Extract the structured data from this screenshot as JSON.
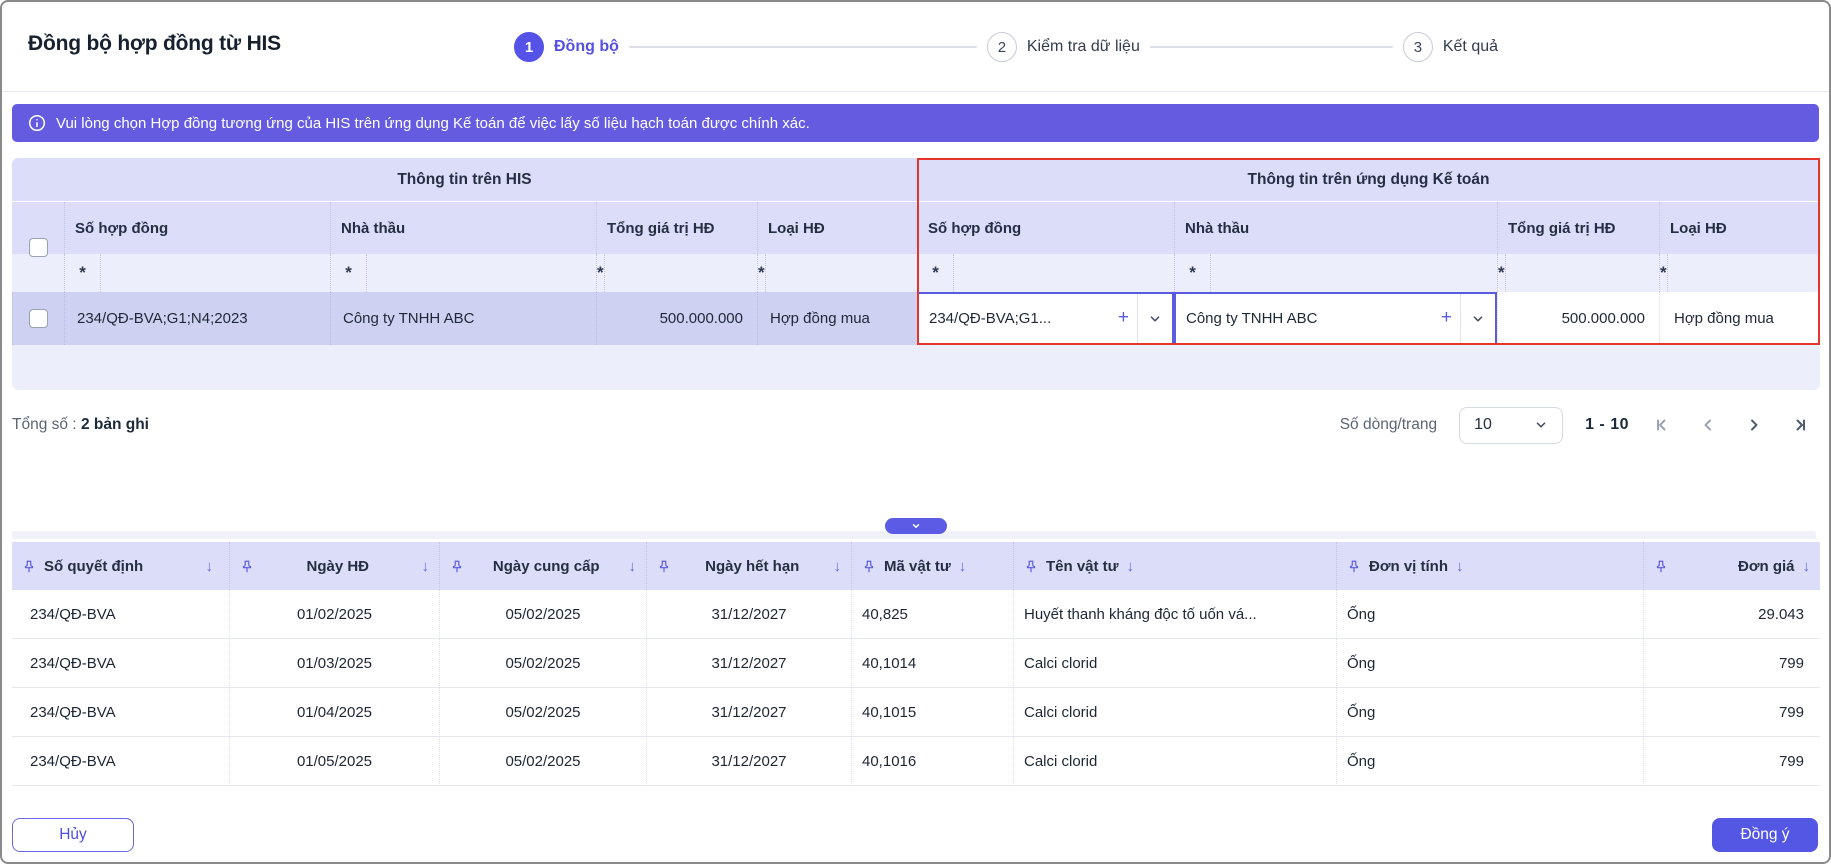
{
  "colors": {
    "accent": "#5552E8",
    "banner_bg": "#655BE1",
    "highlight_border": "#E5342B",
    "table_header_bg": "#DCDDF8",
    "selected_row_bg": "#CFD1F3"
  },
  "icons": {
    "required_marker": "*",
    "add": "+",
    "sort_desc": "↓"
  },
  "page": {
    "title": "Đồng bộ hợp đồng từ HIS"
  },
  "stepper": {
    "steps": [
      {
        "number": "1",
        "label": "Đồng bộ"
      },
      {
        "number": "2",
        "label": "Kiểm tra dữ liệu"
      },
      {
        "number": "3",
        "label": "Kết quả"
      }
    ]
  },
  "banner": {
    "text": "Vui lòng chọn Hợp đồng tương ứng của HIS trên ứng dụng Kế toán để việc lấy số liệu hạch toán được chính xác."
  },
  "contract_table": {
    "group_his": "Thông tin trên HIS",
    "group_acc": "Thông tin trên ứng dụng Kế toán",
    "columns": {
      "so_hop_dong": "Số hợp đồng",
      "nha_thau": "Nhà thầu",
      "tong_gia_tri": "Tổng giá trị HĐ",
      "loai_hd": "Loại HĐ"
    },
    "row": {
      "his": {
        "so_hop_dong": "234/QĐ-BVA;G1;N4;2023",
        "nha_thau": "Công ty TNHH ABC",
        "tong_gia_tri": "500.000.000",
        "loai_hd": "Hợp đồng mua"
      },
      "acc": {
        "so_hop_dong": "234/QĐ-BVA;G1...",
        "nha_thau": "Công ty TNHH ABC",
        "tong_gia_tri": "500.000.000",
        "loai_hd": "Hợp đồng mua"
      }
    }
  },
  "summary": {
    "label": "Tổng số :",
    "value": "2 bản ghi"
  },
  "pagination": {
    "rows_per_page_label": "Số dòng/trang",
    "rows_per_page": "10",
    "range": "1 - 10"
  },
  "detail_table": {
    "columns": [
      "Số quyết định",
      "Ngày HĐ",
      "Ngày cung cấp",
      "Ngày hết hạn",
      "Mã vật tư",
      "Tên vật tư",
      "Đơn vị tính",
      "Đơn giá"
    ],
    "rows": [
      [
        "234/QĐ-BVA",
        "01/02/2025",
        "05/02/2025",
        "31/12/2027",
        "40,825",
        "Huyết thanh kháng độc tố uốn vá...",
        "Ống",
        "29.043"
      ],
      [
        "234/QĐ-BVA",
        "01/03/2025",
        "05/02/2025",
        "31/12/2027",
        "40,1014",
        "Calci clorid",
        "Ống",
        "799"
      ],
      [
        "234/QĐ-BVA",
        "01/04/2025",
        "05/02/2025",
        "31/12/2027",
        "40,1015",
        "Calci clorid",
        "Ống",
        "799"
      ],
      [
        "234/QĐ-BVA",
        "01/05/2025",
        "05/02/2025",
        "31/12/2027",
        "40,1016",
        "Calci clorid",
        "Ống",
        "799"
      ]
    ]
  },
  "actions": {
    "cancel": "Hủy",
    "confirm": "Đồng ý"
  }
}
